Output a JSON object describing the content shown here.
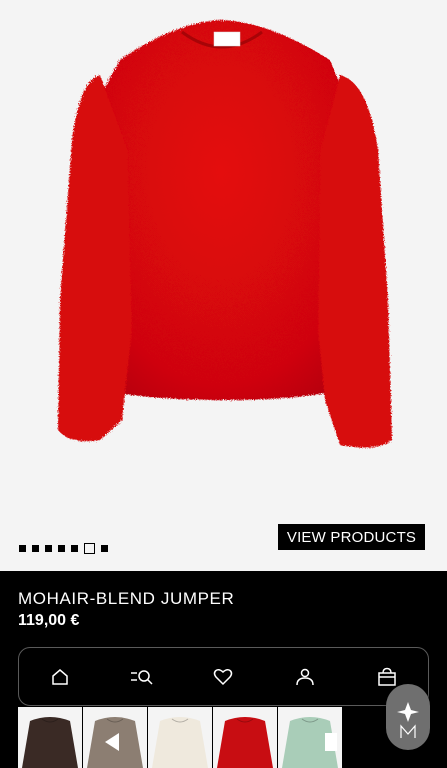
{
  "product": {
    "view_products_label": "VIEW PRODUCTS",
    "name": "MOHAIR-BLEND JUMPER",
    "price": "119,00 €",
    "color": "#d8080b"
  },
  "carousel": {
    "total_dots": 7,
    "active_index": 5
  },
  "nav": {
    "items": [
      {
        "icon": "home-icon"
      },
      {
        "icon": "search-list-icon"
      },
      {
        "icon": "heart-icon"
      },
      {
        "icon": "user-icon"
      },
      {
        "icon": "shopping-bag-icon"
      }
    ]
  },
  "thumbnails": [
    {
      "color": "#3a2a25"
    },
    {
      "color": "#8c7e72"
    },
    {
      "color": "#efe9dd"
    },
    {
      "color": "#c80d12"
    },
    {
      "color": "#a9cdb8"
    }
  ],
  "assistant": {
    "icon": "brand-logo-icon"
  }
}
